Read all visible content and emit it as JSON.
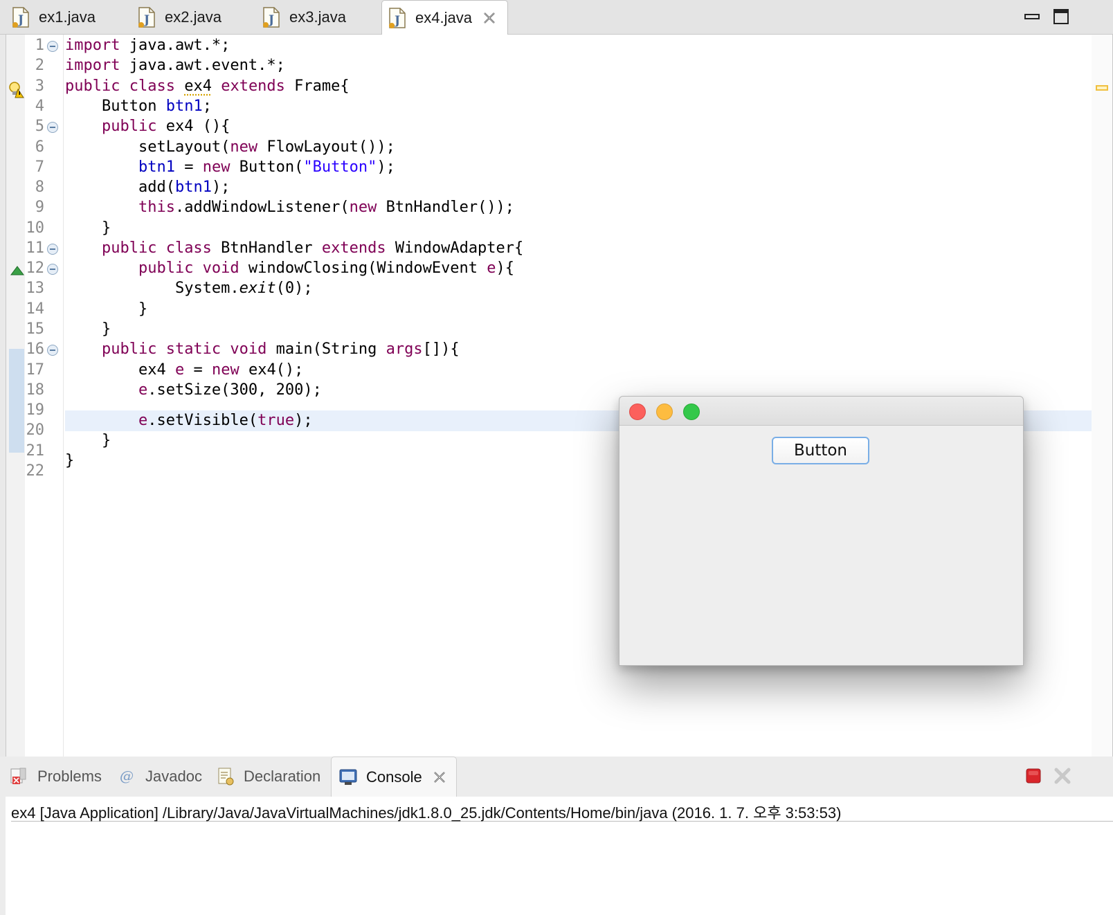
{
  "editor_tabs": [
    {
      "label": "ex1.java"
    },
    {
      "label": "ex2.java"
    },
    {
      "label": "ex3.java"
    },
    {
      "label": "ex4.java"
    }
  ],
  "line_numbers": [
    "1",
    "2",
    "3",
    "4",
    "5",
    "6",
    "7",
    "8",
    "9",
    "10",
    "11",
    "12",
    "13",
    "14",
    "15",
    "16",
    "17",
    "18",
    "19",
    "20",
    "21",
    "22"
  ],
  "code": {
    "l1_kw": "import",
    "l1_rest": " java.awt.*;",
    "l2_kw": "import",
    "l2_rest": " java.awt.event.*;",
    "l3_kw1": "public class",
    "l3_cls": "ex4",
    "l3_kw2": "extends",
    "l3_rest": " Frame{",
    "l4_type": "Button",
    "l4_fld": "btn1",
    "l4_end": ";",
    "l5_kw": "public",
    "l5_rest": " ex4 (){",
    "l6_pre": "setLayout(",
    "l6_kw": "new",
    "l6_rest": " FlowLayout());",
    "l7_fld": "btn1",
    "l7_eq": " = ",
    "l7_kw": "new",
    "l7_mid": " Button(",
    "l7_str": "\"Button\"",
    "l7_end": ");",
    "l8_pre": "add(",
    "l8_fld": "btn1",
    "l8_end": ");",
    "l9_kw": "this",
    "l9_mid": ".addWindowListener(",
    "l9_kw2": "new",
    "l9_end": " BtnHandler());",
    "l10": "}",
    "l11_kw1": "public class",
    "l11_mid": " BtnHandler ",
    "l11_kw2": "extends",
    "l11_end": " WindowAdapter{",
    "l12_kw": "public void",
    "l12_mid": " windowClosing(WindowEvent ",
    "l12_param": "e",
    "l12_end": "){",
    "l13_pre": "System.",
    "l13_it": "exit",
    "l13_end": "(0);",
    "l14": "}",
    "l15": "}",
    "l16_kw": "public static void",
    "l16_mid": " main(String ",
    "l16_param": "args",
    "l16_end": "[]){",
    "l17_pre": "ex4 ",
    "l17_var": "e",
    "l17_eq": " = ",
    "l17_kw": "new",
    "l17_end": " ex4();",
    "l18_var": "e",
    "l18_end": ".setSize(300, 200);",
    "l19_var": "e",
    "l19_mid": ".setVisible(",
    "l19_kw": "true",
    "l19_end": ");",
    "l20": "}",
    "l21": "}"
  },
  "frame_window": {
    "button_label": "Button",
    "traffic_colors": {
      "close": "#fc605c",
      "minimize": "#fdbc40",
      "zoom": "#34c84a"
    }
  },
  "bottom_tabs": [
    {
      "label": "Problems"
    },
    {
      "label": "Javadoc"
    },
    {
      "label": "Declaration"
    },
    {
      "label": "Console"
    }
  ],
  "console": {
    "header": "ex4 [Java Application] /Library/Java/JavaVirtualMachines/jdk1.8.0_25.jdk/Contents/Home/bin/java (2016. 1. 7. 오후 3:53:53)"
  },
  "icons": {
    "java_file": "java-file-icon",
    "close": "close-icon",
    "minimize": "minimize-icon",
    "maximize": "maximize-icon",
    "problems": "problems-icon",
    "javadoc": "javadoc-icon",
    "declaration": "declaration-icon",
    "console": "console-icon",
    "terminate": "terminate-icon",
    "remove_launch": "remove-launch-icon"
  }
}
